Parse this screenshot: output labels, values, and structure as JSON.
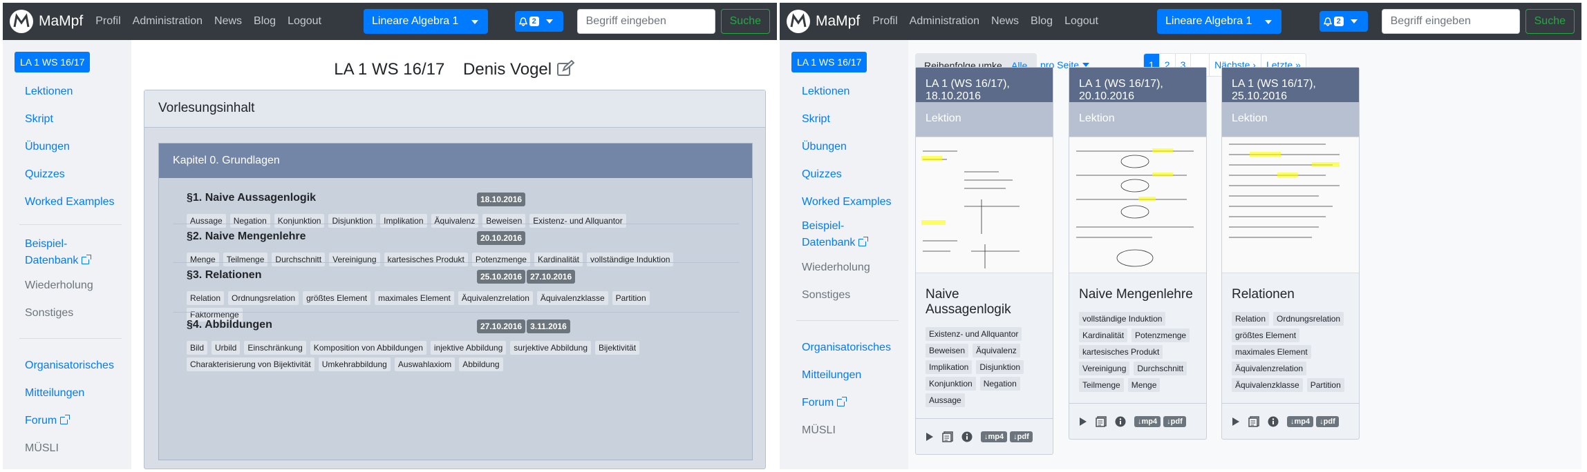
{
  "brand": "MaMpf",
  "nav": {
    "links": [
      "Profil",
      "Administration",
      "News",
      "Blog",
      "Logout"
    ],
    "course": "Lineare Algebra 1",
    "notif_count": "2",
    "search_placeholder": "Begriff eingeben",
    "search_button": "Suche"
  },
  "sidebar": {
    "badge": "LA 1 WS 16/17",
    "items": [
      "Lektionen",
      "Skript",
      "Übungen",
      "Quizzes",
      "Worked Examples"
    ],
    "beispiel_1": "Beispiel-",
    "beispiel_2": "Datenbank",
    "wiederholung": "Wiederholung",
    "sonstiges": "Sonstiges",
    "items2": [
      "Organisatorisches",
      "Mitteilungen",
      "Forum"
    ],
    "muesli": "MÜSLI"
  },
  "main": {
    "title": "LA 1 WS 16/17    Denis Vogel",
    "card_title": "Vorlesungsinhalt",
    "chapter": "Kapitel 0. Grundlagen",
    "sections": [
      {
        "title": "§1. Naive Aussagenlogik",
        "dates": [
          "18.10.2016"
        ],
        "tags": [
          "Aussage",
          "Negation",
          "Konjunktion",
          "Disjunktion",
          "Implikation",
          "Äquivalenz",
          "Beweisen",
          "Existenz- und Allquantor"
        ]
      },
      {
        "title": "§2. Naive Mengenlehre",
        "dates": [
          "20.10.2016"
        ],
        "tags": [
          "Menge",
          "Teilmenge",
          "Durchschnitt",
          "Vereinigung",
          "kartesisches Produkt",
          "Potenzmenge",
          "Kardinalität",
          "vollständige Induktion"
        ]
      },
      {
        "title": "§3. Relationen",
        "dates": [
          "25.10.2016",
          "27.10.2016"
        ],
        "tags": [
          "Relation",
          "Ordnungsrelation",
          "größtes Element",
          "maximales Element",
          "Äquivalenzrelation",
          "Äquivalenzklasse",
          "Partition",
          "Faktormenge"
        ]
      },
      {
        "title": "§4. Abbildungen",
        "dates": [
          "27.10.2016",
          "3.11.2016"
        ],
        "tags": [
          "Bild",
          "Urbild",
          "Einschränkung",
          "Komposition von Abbildungen",
          "injektive Abbildung",
          "surjektive Abbildung",
          "Bijektivität",
          "Charakterisierung von Bijektivität",
          "Umkehrabbildung",
          "Auswahlaxiom",
          "Abbildung"
        ]
      }
    ]
  },
  "lessons": {
    "reverse": "Reihenfolge umkehren",
    "all": "Alle",
    "per_page": "pro Seite",
    "pager": [
      "1",
      "2",
      "3",
      "...",
      "Nächste ›",
      "Letzte »"
    ],
    "sub": "Lektion",
    "mp4": "↓mp4",
    "pdf": "↓pdf",
    "cards": [
      {
        "head": "LA 1 (WS 16/17), 18.10.2016",
        "title": "Naive Aussagenlogik",
        "tags": [
          "Existenz- und Allquantor",
          "Beweisen",
          "Äquivalenz",
          "Implikation",
          "Disjunktion",
          "Konjunktion",
          "Negation",
          "Aussage"
        ]
      },
      {
        "head": "LA 1 (WS 16/17), 20.10.2016",
        "title": "Naive Mengenlehre",
        "tags": [
          "vollständige Induktion",
          "Kardinalität",
          "Potenzmenge",
          "kartesisches Produkt",
          "Vereinigung",
          "Durchschnitt",
          "Teilmenge",
          "Menge"
        ]
      },
      {
        "head": "LA 1 (WS 16/17), 25.10.2016",
        "title": "Relationen",
        "tags": [
          "Relation",
          "Ordnungsrelation",
          "größtes Element",
          "maximales Element",
          "Äquivalenzrelation",
          "Äquivalenzklasse",
          "Partition"
        ]
      }
    ]
  }
}
